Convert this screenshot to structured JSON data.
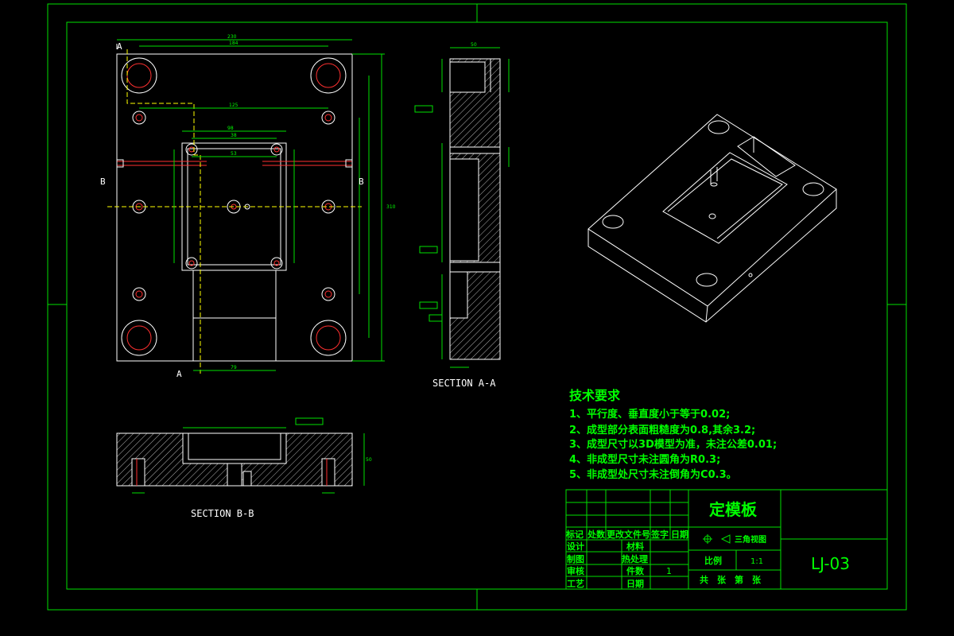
{
  "views": {
    "section_aa": "SECTION A-A",
    "section_bb": "SECTION B-B",
    "cut_a_top": "A",
    "cut_a_bottom": "A",
    "cut_b_left": "B",
    "cut_b_right": "B"
  },
  "requirements": {
    "heading": "技术要求",
    "items": [
      "1、平行度、垂直度小于等于0.02;",
      "2、成型部分表面粗糙度为0.8,其余3.2;",
      "3、成型尺寸以3D模型为准，未注公差0.01;",
      "4、非成型尺寸未注圆角为R0.3;",
      "5、非成型处尺寸未注倒角为C0.3。"
    ]
  },
  "title_block": {
    "part_name": "定模板",
    "drawing_no": "LJ-03",
    "projection": "三角视图",
    "scale_label": "比例",
    "scale_value": "1:1",
    "sheets": "共　张　第　张",
    "row_header": [
      "标记",
      "处数",
      "更改文件号",
      "签字",
      "日期"
    ],
    "design": "设计",
    "drafting": "制图",
    "review": "审核",
    "process": "工艺",
    "material": "材料",
    "heat_treatment": "热处理",
    "quantity_label": "件数",
    "quantity_value": "1",
    "date_label": "日期"
  },
  "dimensions": {
    "plan_w1": "230",
    "plan_w2": "184",
    "plan_w3": "125",
    "plan_w4": "98",
    "plan_w5": "38",
    "plan_w6": "53",
    "plan_w7": "79",
    "plan_h1": "310",
    "aa_w": "50",
    "bb_h": "50"
  }
}
